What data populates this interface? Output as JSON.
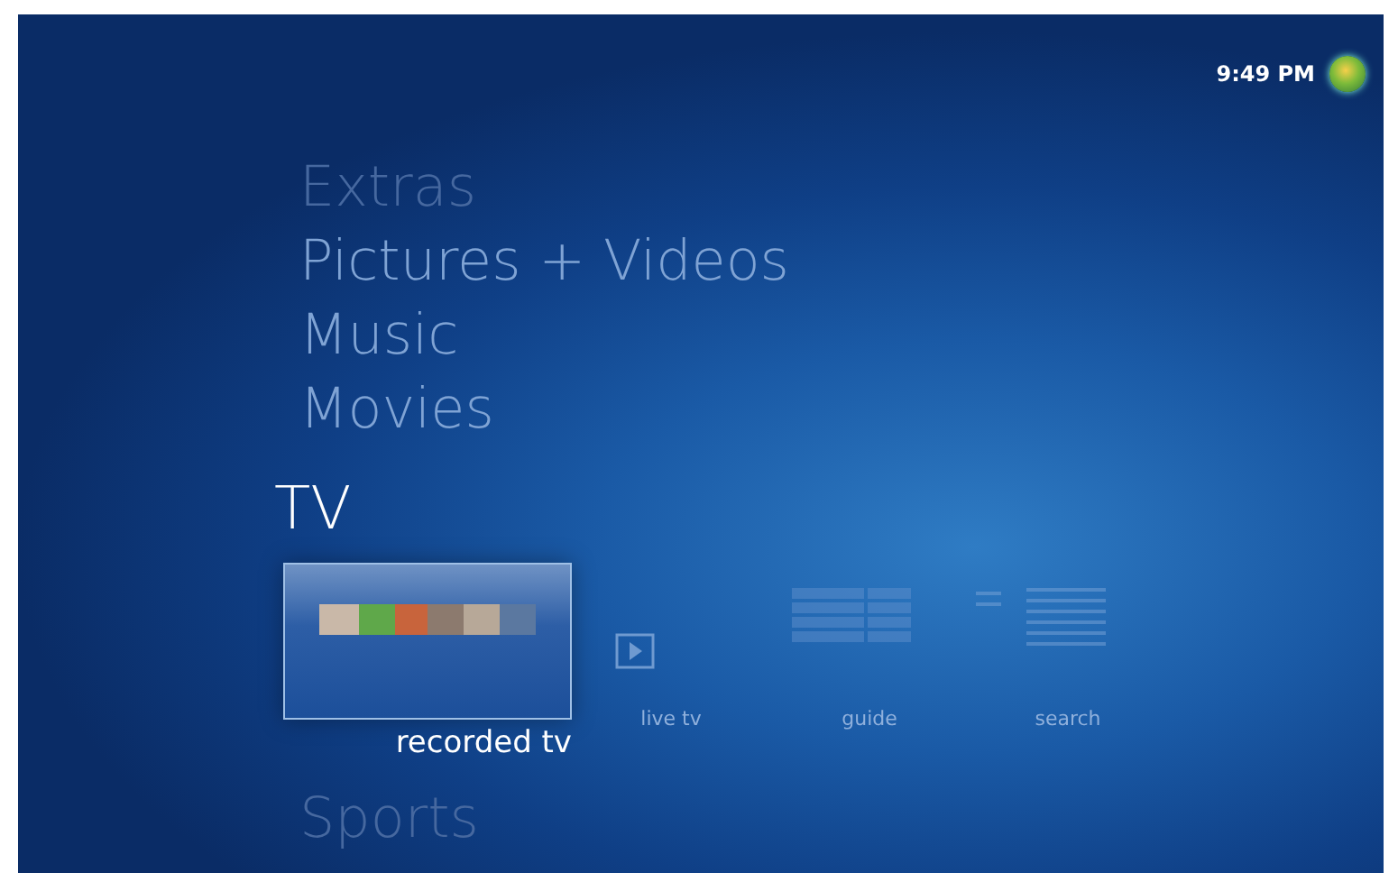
{
  "clock": "9:49 PM",
  "categories": [
    {
      "label": "Extras",
      "selected": false
    },
    {
      "label": "Pictures + Videos",
      "selected": false
    },
    {
      "label": "Music",
      "selected": false
    },
    {
      "label": "Movies",
      "selected": false
    },
    {
      "label": "TV",
      "selected": true,
      "items": [
        {
          "label": "recorded tv",
          "kind": "thumbnails",
          "selected": true
        },
        {
          "label": "live tv",
          "kind": "play",
          "selected": false
        },
        {
          "label": "guide",
          "kind": "grid",
          "selected": false
        },
        {
          "label": "search",
          "kind": "list",
          "selected": false
        }
      ]
    },
    {
      "label": "Sports",
      "selected": false
    }
  ]
}
